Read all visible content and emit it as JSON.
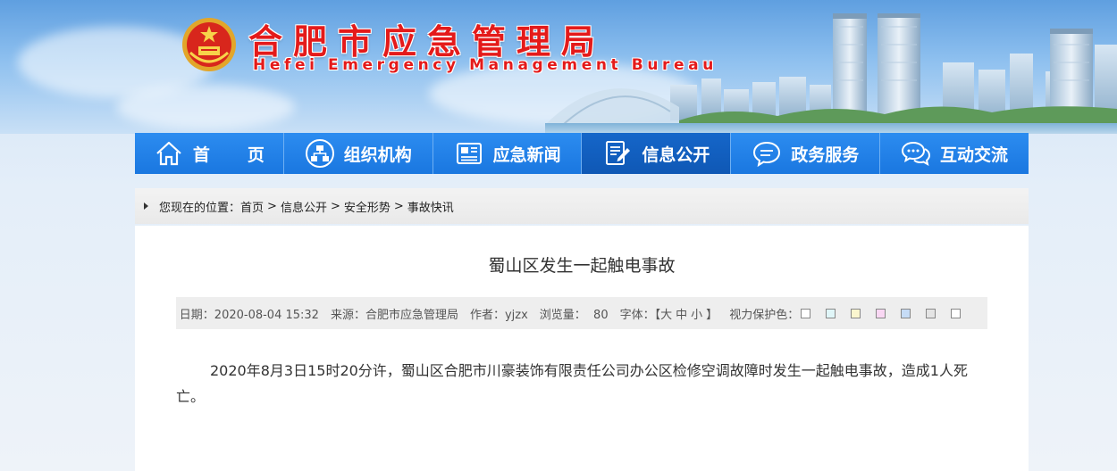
{
  "header": {
    "title_cn": "合肥市应急管理局",
    "title_en": "Hefei Emergency Management Bureau"
  },
  "nav": {
    "items": [
      {
        "label": "首页",
        "icon": "home-icon"
      },
      {
        "label": "组织机构",
        "icon": "org-chart-icon"
      },
      {
        "label": "应急新闻",
        "icon": "newspaper-icon"
      },
      {
        "label": "信息公开",
        "icon": "document-edit-icon"
      },
      {
        "label": "政务服务",
        "icon": "chat-bubble-icon"
      },
      {
        "label": "互动交流",
        "icon": "chat-bubbles-icon"
      }
    ],
    "active_index": 3
  },
  "breadcrumb": {
    "prefix": "您现在的位置：",
    "items": [
      "首页",
      "信息公开",
      "安全形势",
      "事故快讯"
    ],
    "separator": ">"
  },
  "article": {
    "title": "蜀山区发生一起触电事故",
    "meta": {
      "date": "日期：2020-08-04 15:32",
      "source": "来源：合肥市应急管理局",
      "author": "作者：yjzx",
      "views": "浏览量：  80",
      "font_label": "字体：【",
      "font_large": "大",
      "font_medium": "中",
      "font_small": "小",
      "font_close": "】",
      "eye_label": "视力保护色："
    },
    "eye_colors": [
      "#ffffff",
      "#e0f6f8",
      "#fbf6cf",
      "#f9d7f3",
      "#c6dcf6",
      "#e4e4e4",
      "#ffffff"
    ],
    "body": "2020年8月3日15时20分许，蜀山区合肥市川豪装饰有限责任公司办公区检修空调故障时发生一起触电事故，造成1人死亡。"
  }
}
